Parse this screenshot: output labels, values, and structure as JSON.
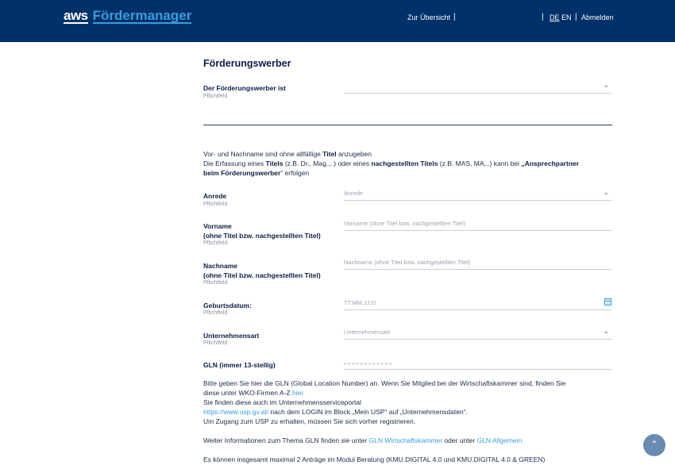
{
  "header": {
    "logo_aws": "aws",
    "logo_product": "Fördermanager",
    "nav_overview": "Zur Übersicht",
    "nav_sep": "|",
    "lang_de": "DE",
    "lang_en": "EN",
    "logout": "Abmelden",
    "bg_color": "#003169",
    "accent_color": "#3a9ddf"
  },
  "form": {
    "section_title": "Förderungswerber",
    "required_hint": "Pflichtfeld",
    "foerderungswerber_label": "Der Förderungswerber ist",
    "intro_line1_pre": "Vor- und Nachname sind ohne allfällige ",
    "intro_line1_bold": "Titel",
    "intro_line1_post": " anzugeben",
    "intro_line2_a": "Die Erfassung eines ",
    "intro_line2_b": "Titels",
    "intro_line2_c": " (z.B. Dr., Mag.,..) oder eines ",
    "intro_line2_d": "nachgestellten Titels",
    "intro_line2_e": " (z.B. MAS, MA,..) kann bei ",
    "intro_line2_f": "„Ansprechpartner",
    "intro_line3_a": "beim Förderungswerber",
    "intro_line3_b": "“ erfolgen",
    "anrede_label": "Anrede",
    "anrede_placeholder": "Anrede",
    "vorname_label_1": "Vorname",
    "vorname_label_2": "(ohne Titel bzw. nachgestellten Titel)",
    "vorname_placeholder": "Vorname (ohne Titel bzw. nachgestellten Titel)",
    "nachname_label_1": "Nachname",
    "nachname_label_2": "(ohne Titel bzw. nachgestellten Titel)",
    "nachname_placeholder": "Nachname (ohne Titel bzw. nachgestellten Titel)",
    "geburtsdatum_label": "Geburtsdatum:",
    "geburtsdatum_placeholder": "TT.MM.JJJJ",
    "unternehmensart_label": "Unternehmensart",
    "unternehmensart_placeholder": "Unternehmensart",
    "gln_label": "GLN (immer 13-stellig)"
  },
  "gln_info": {
    "p1_a": "Bitte geben Sie hier die GLN (Global Location Number) an. Wenn Sie Mitglied bei der Wirtschaftskammer sind, finden Sie",
    "p1_b": "diese unter WKO-Firmen A-Z ",
    "p1_link": "hier.",
    "p2": "Sie finden diese auch im Unternehmensserviceportal",
    "p3_link": "https://www.usp.gv.at/",
    "p3_rest": " nach dem LOGIN im Block „Mein USP“ auf „Unternehmensdaten“.",
    "p4": "Um Zugang zum USP zu erhalten, müssen Sie sich vorher registrieren.",
    "p5_a": "Weiter Informationen zum Thema GLN finden sie unter ",
    "p5_link1": "GLN Wirtschaftskammer",
    "p5_b": " oder unter ",
    "p5_link2": "GLN Allgemein",
    "p6": "Es können insgesamt maximal 2 Anträge im Modul Beratung (KMU.DIGITAL 4.0 und KMU.DIGITAL 4.0 & GREEN)"
  }
}
